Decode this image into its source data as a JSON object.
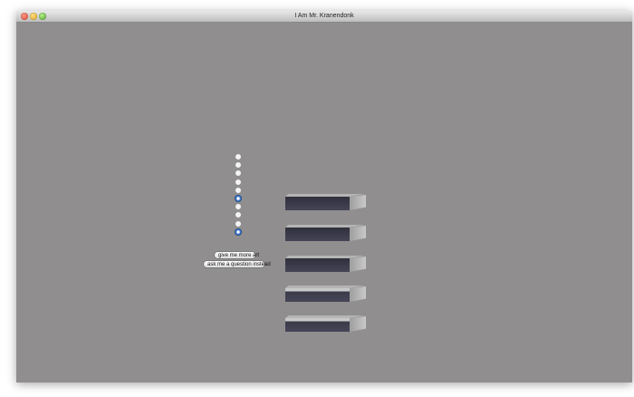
{
  "window": {
    "title": "I Am Mr. Kranendonk"
  },
  "controls": {
    "radio_buttons": [
      {
        "selected": false
      },
      {
        "selected": false
      },
      {
        "selected": false
      },
      {
        "selected": false
      },
      {
        "selected": false
      },
      {
        "selected": true
      },
      {
        "selected": false
      },
      {
        "selected": false
      },
      {
        "selected": false
      },
      {
        "selected": true
      }
    ],
    "give_more_art_label": "give me more art",
    "ask_question_label": "ask me a question instead"
  },
  "artwork": {
    "shelf_count": 5
  }
}
